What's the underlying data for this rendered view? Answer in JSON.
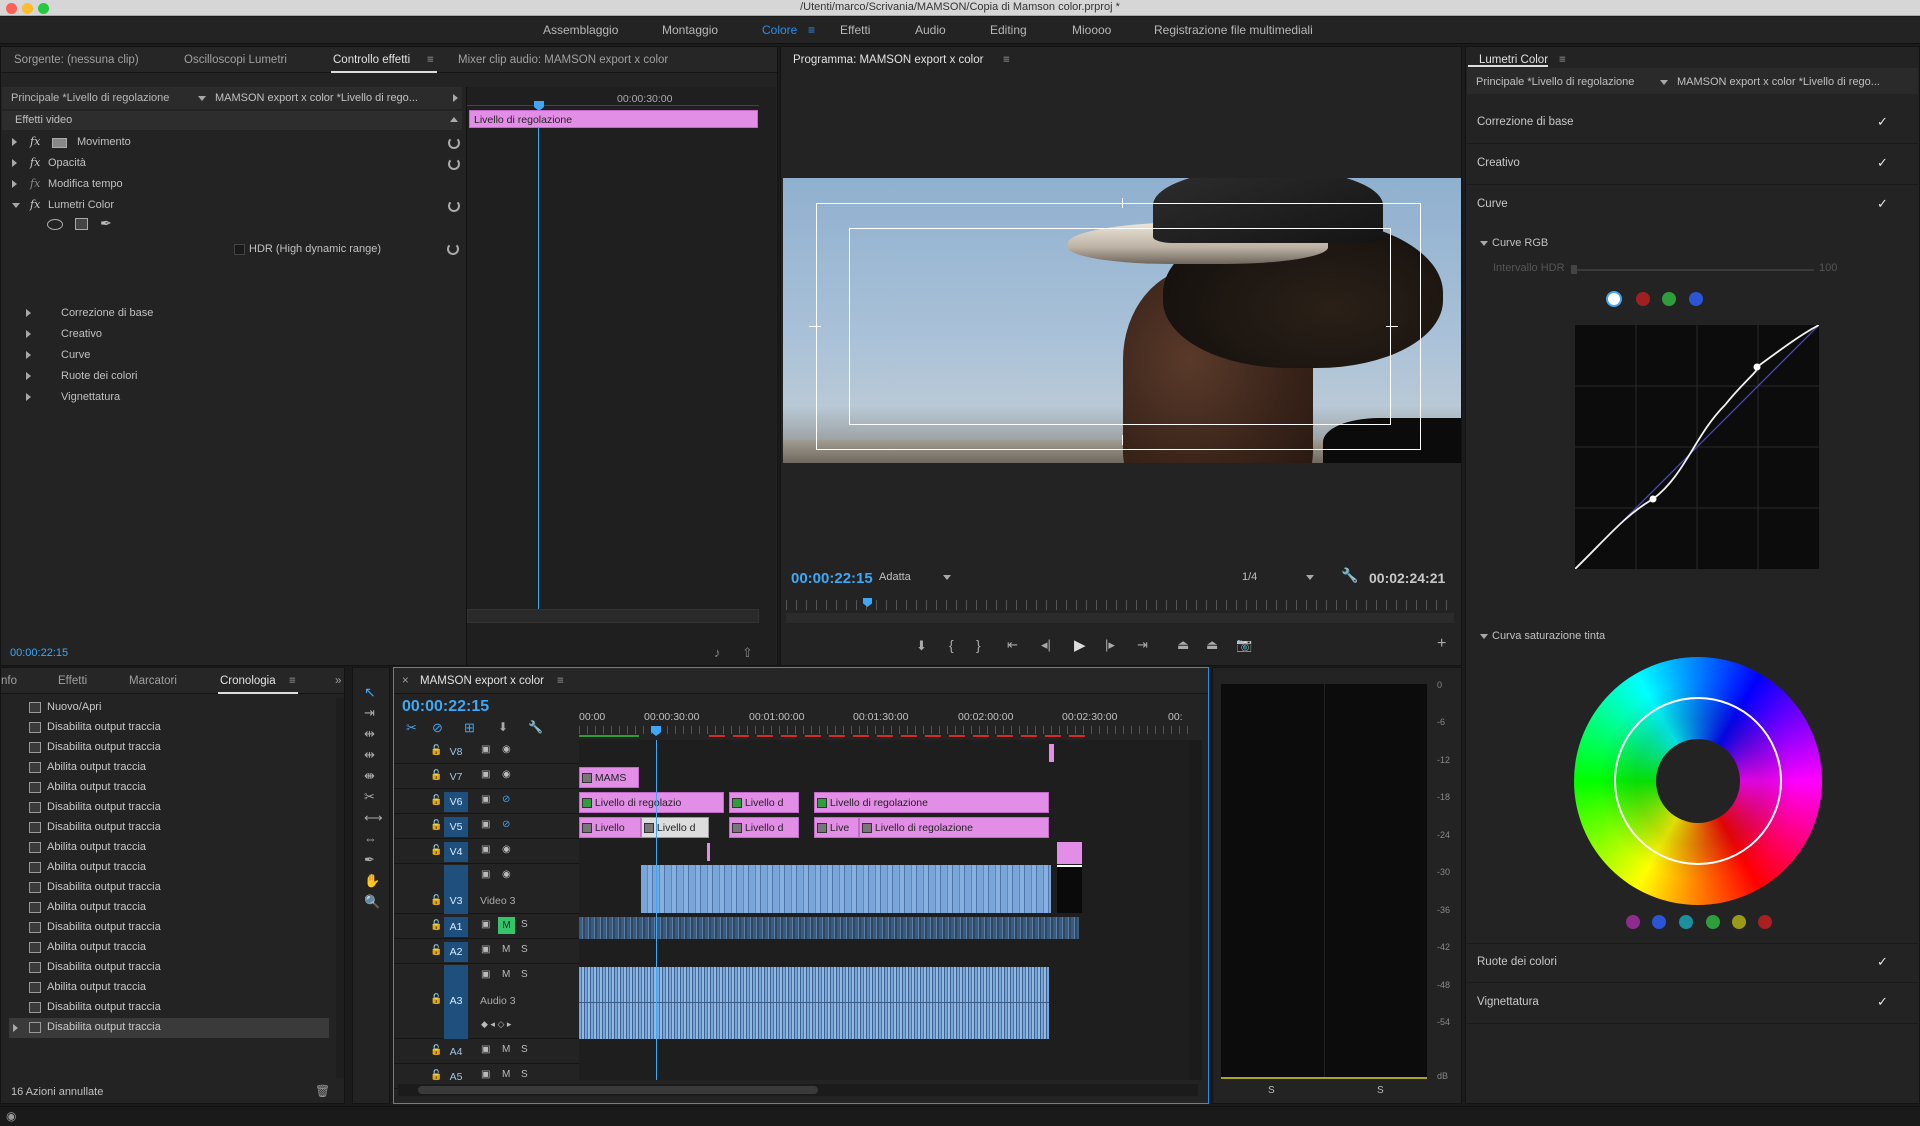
{
  "window": {
    "title": "/Utenti/marco/Scrivania/MAMSON/Copia di Mamson color.prproj *"
  },
  "workspaces": [
    {
      "label": "Assemblaggio",
      "active": false
    },
    {
      "label": "Montaggio",
      "active": false
    },
    {
      "label": "Colore",
      "active": true
    },
    {
      "label": "Effetti",
      "active": false
    },
    {
      "label": "Audio",
      "active": false
    },
    {
      "label": "Editing",
      "active": false
    },
    {
      "label": "Mioooo",
      "active": false
    },
    {
      "label": "Registrazione file multimediali",
      "active": false
    }
  ],
  "effectControls": {
    "tabs": [
      "Sorgente: (nessuna clip)",
      "Oscilloscopi Lumetri",
      "Controllo effetti",
      "Mixer clip audio: MAMSON export x color"
    ],
    "activeTab": "Controllo effetti",
    "source": "Principale *Livello di regolazione",
    "target": "MAMSON export x color *Livello di rego...",
    "timeRuler": "00:00:30:00",
    "clipLabel": "Livello di regolazione",
    "sectionTitle": "Effetti video",
    "effects": [
      "Movimento",
      "Opacità",
      "Modifica tempo",
      "Lumetri Color"
    ],
    "hdrLabel": "HDR (High dynamic range)",
    "subsections": [
      "Correzione di base",
      "Creativo",
      "Curve",
      "Ruote dei colori",
      "Vignettatura"
    ],
    "timecode": "00:00:22:15"
  },
  "program": {
    "title": "Programma: MAMSON export x color",
    "timecode": "00:00:22:15",
    "fit": "Adatta",
    "resolution": "1/4",
    "duration": "00:02:24:21"
  },
  "lumetri": {
    "title": "Lumetri Color",
    "source": "Principale *Livello di regolazione",
    "target": "MAMSON export x color *Livello di rego...",
    "sections": [
      "Correzione di base",
      "Creativo",
      "Curve"
    ],
    "curveRgb": "Curve RGB",
    "hdrRange": "Intervallo HDR",
    "hdrValue": "100",
    "hueSat": "Curva saturazione tinta",
    "bottomSections": [
      "Ruote dei colori",
      "Vignettatura"
    ],
    "channelColors": [
      "#ffffff",
      "#c0392b",
      "#2e9e3b",
      "#2b55d6"
    ],
    "swatchColors": [
      "#8e2c8e",
      "#2b55d6",
      "#1b8fa0",
      "#2e9e3b",
      "#9a9a1a",
      "#a82020"
    ]
  },
  "history": {
    "tabs": [
      "nfo",
      "Effetti",
      "Marcatori",
      "Cronologia"
    ],
    "activeTab": "Cronologia",
    "items": [
      "Nuovo/Apri",
      "Disabilita output traccia",
      "Disabilita output traccia",
      "Abilita output traccia",
      "Abilita output traccia",
      "Disabilita output traccia",
      "Disabilita output traccia",
      "Abilita output traccia",
      "Abilita output traccia",
      "Disabilita output traccia",
      "Abilita output traccia",
      "Disabilita output traccia",
      "Abilita output traccia",
      "Disabilita output traccia",
      "Abilita output traccia",
      "Disabilita output traccia",
      "Disabilita output traccia"
    ],
    "footer": "16 Azioni annullate"
  },
  "timeline": {
    "title": "MAMSON export x color",
    "timecode": "00:00:22:15",
    "ruler": [
      "00:00",
      "00:00:30:00",
      "00:01:00:00",
      "00:01:30:00",
      "00:02:00:00",
      "00:02:30:00",
      "00:"
    ],
    "tracks": [
      "V8",
      "V7",
      "V6",
      "V5",
      "V4",
      "V3",
      "A1",
      "A2",
      "A3",
      "A4",
      "A5"
    ],
    "v3Name": "Video 3",
    "a3Name": "Audio 3",
    "clips": {
      "v7": "MAMS",
      "v6a": "Livello di regolazio",
      "v6b": "Livello d",
      "v6c": "Livello di regolazione",
      "v5a": "Livello",
      "v5b": "Livello d",
      "v5c": "Livello d",
      "v5d": "Live",
      "v5e": "Livello di regolazione"
    }
  },
  "meter": {
    "scale": [
      "0",
      "-6",
      "-12",
      "-18",
      "-24",
      "-30",
      "-36",
      "-42",
      "-48",
      "-54",
      "dB"
    ],
    "solo": [
      "S",
      "S"
    ]
  }
}
